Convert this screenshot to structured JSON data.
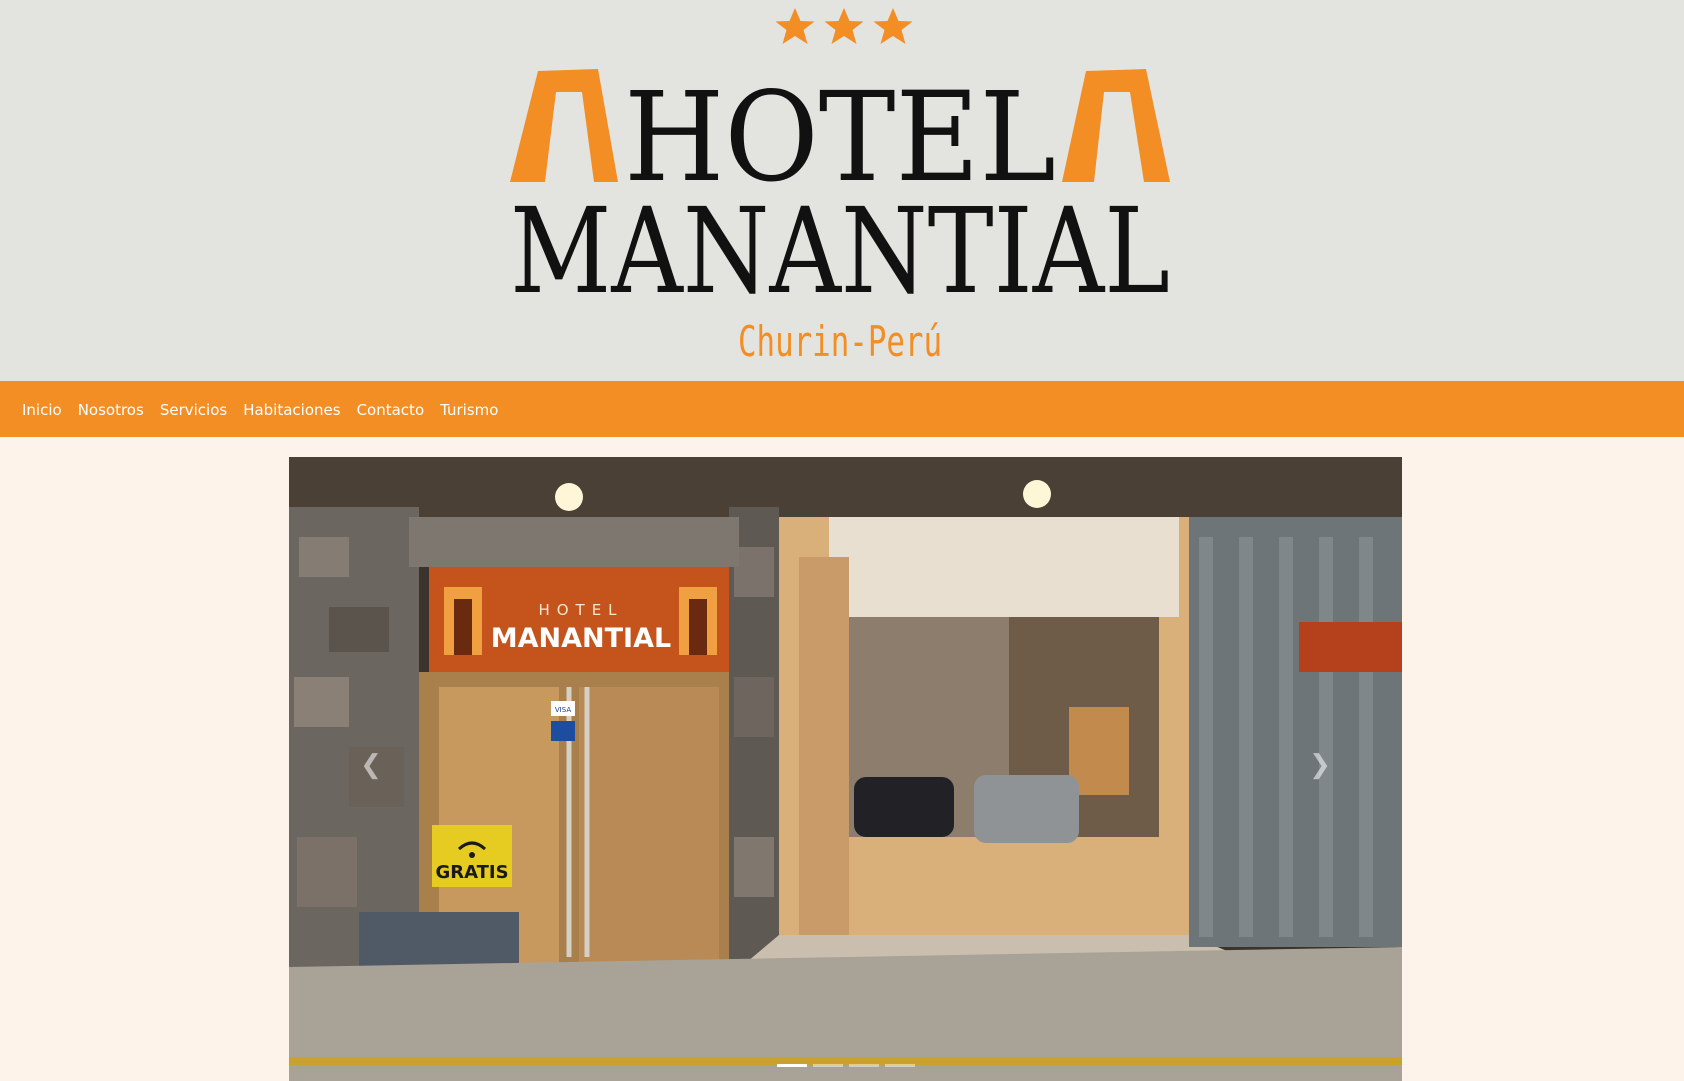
{
  "header": {
    "logo": {
      "word1": "HOTEL",
      "word2": "MANANTIAL",
      "location": "Churin-Perú",
      "stars": 3
    }
  },
  "nav": {
    "items": [
      {
        "label": "Inicio"
      },
      {
        "label": "Nosotros"
      },
      {
        "label": "Servicios"
      },
      {
        "label": "Habitaciones"
      },
      {
        "label": "Contacto"
      },
      {
        "label": "Turismo"
      }
    ]
  },
  "carousel": {
    "prev_icon": "chevron-left-icon",
    "next_icon": "chevron-right-icon",
    "slide_count": 4,
    "active_slide": 1,
    "photo_signs": {
      "hotel": "HOTEL",
      "name": "MANANTIAL",
      "wifi": "GRATIS",
      "card": "VISA"
    }
  },
  "colors": {
    "header_bg": "#e3e3e0",
    "nav_bg": "#f28e24",
    "logo_orange": "#f28e24",
    "logo_black": "#111111",
    "page_bg": "#fdf3ea"
  }
}
